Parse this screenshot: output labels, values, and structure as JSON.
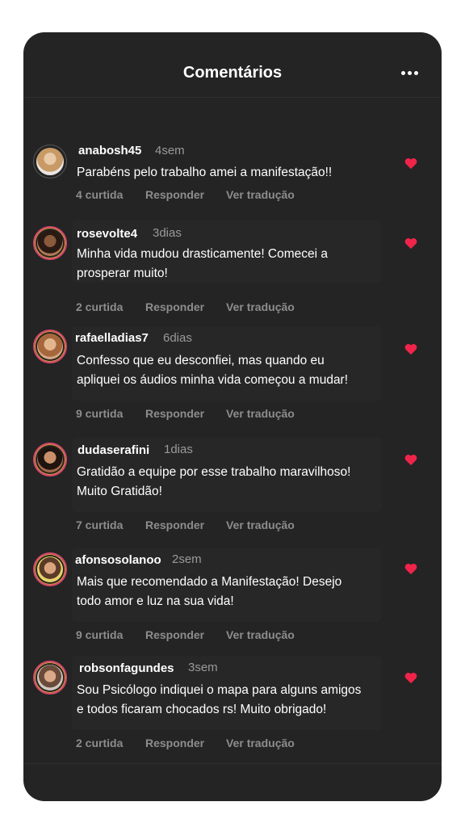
{
  "header": {
    "title": "Comentários",
    "more_icon": "more-horizontal-icon"
  },
  "colors": {
    "background": "#242424",
    "heart": "#f0244a",
    "story_ring": "#d4486e"
  },
  "actions_labels": {
    "reply": "Responder",
    "translate": "Ver tradução"
  },
  "comments": [
    {
      "username": "anabosh45",
      "time": "4sem",
      "text_lines": [
        "Parabéns pelo trabalho amei a manifestação!!"
      ],
      "likes": "4 curtida"
    },
    {
      "username": "rosevolte4",
      "time": "3dias",
      "text_lines": [
        "Minha vida mudou drasticamente! Comecei a",
        "prosperar muito!"
      ],
      "likes": "2 curtida"
    },
    {
      "username": "rafaelladias7",
      "time": "6dias",
      "text_lines": [
        "Confesso que eu desconfiei, mas quando eu",
        "apliquei os áudios minha vida começou a mudar!"
      ],
      "likes": "9 curtida"
    },
    {
      "username": "dudaserafini",
      "time": "1dias",
      "text_lines": [
        "Gratidão a equipe  por esse trabalho maravilhoso!",
        "Muito Gratidão!"
      ],
      "likes": "7 curtida"
    },
    {
      "username": "afonsosolanoo",
      "time": "2sem",
      "text_lines": [
        "Mais que recomendado a Manifestação! Desejo",
        "todo amor e luz na sua vida!"
      ],
      "likes": "9 curtida"
    },
    {
      "username": "robsonfagundes",
      "time": "3sem",
      "text_lines": [
        "Sou Psicólogo indiquei o mapa para alguns amigos",
        "e todos ficaram chocados rs! Muito obrigado!"
      ],
      "likes": "2 curtida"
    }
  ]
}
